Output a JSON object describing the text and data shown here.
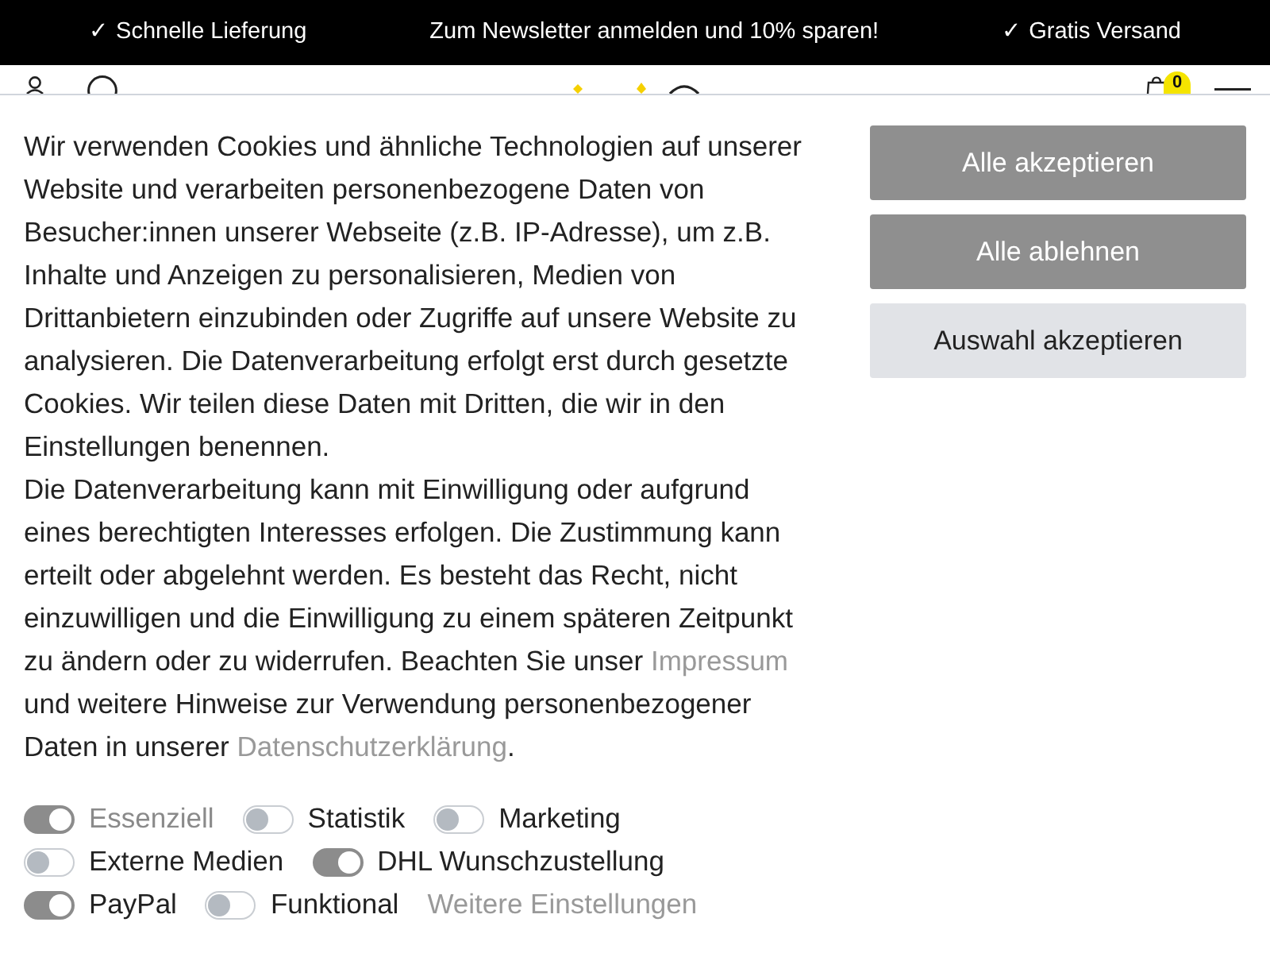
{
  "top_bar": {
    "items": [
      "✓ Schnelle Lieferung",
      "Zum Newsletter anmelden und 10% sparen!",
      "✓ Gratis Versand"
    ]
  },
  "header": {
    "cart_badge": "0"
  },
  "cookie_banner": {
    "paragraphs": [
      [
        {
          "kind": "text",
          "text": "Wir verwenden Cookies und ähnliche Technologien auf unserer Website und verarbeiten personenbezogene Daten von Besucher:innen unserer Webseite (z.B. IP-Adresse), um z.B. Inhalte und Anzeigen zu personalisieren, Medien von Drittanbietern einzubinden oder Zugriffe auf unsere Website zu analysieren. Die Datenverarbeitung erfolgt erst durch gesetzte Cookies. Wir teilen diese Daten mit Dritten, die wir in den Einstellungen benennen."
        }
      ],
      [
        {
          "kind": "text",
          "text": "Die Datenverarbeitung kann mit Einwilligung oder aufgrund eines berechtigten Interesses erfolgen. Die Zustimmung kann erteilt oder abgelehnt werden. Es besteht das Recht, nicht einzuwilligen und die Einwilligung zu einem späteren Zeitpunkt zu ändern oder zu widerrufen. Beachten Sie unser "
        },
        {
          "kind": "link",
          "text": "Impressum"
        },
        {
          "kind": "text",
          "text": " und weitere Hinweise zur Verwendung personenbezogener Daten in unserer "
        },
        {
          "kind": "link",
          "text": "Datenschutzerklärung"
        },
        {
          "kind": "text",
          "text": "."
        }
      ]
    ],
    "toggles": [
      {
        "label": "Essenziell",
        "on": true,
        "disabled": true
      },
      {
        "label": "Statistik",
        "on": false,
        "disabled": false
      },
      {
        "label": "Marketing",
        "on": false,
        "disabled": false
      },
      {
        "label": "Externe Medien",
        "on": false,
        "disabled": false
      },
      {
        "label": "DHL Wunschzustellung",
        "on": true,
        "disabled": false
      },
      {
        "label": "PayPal",
        "on": true,
        "disabled": false
      },
      {
        "label": "Funktional",
        "on": false,
        "disabled": false
      }
    ],
    "more_link": "Weitere Einstellungen",
    "buttons": [
      {
        "label": "Alle akzeptieren",
        "kind": "primary"
      },
      {
        "label": "Alle ablehnen",
        "kind": "primary"
      },
      {
        "label": "Auswahl akzeptieren",
        "kind": "secondary"
      }
    ]
  }
}
